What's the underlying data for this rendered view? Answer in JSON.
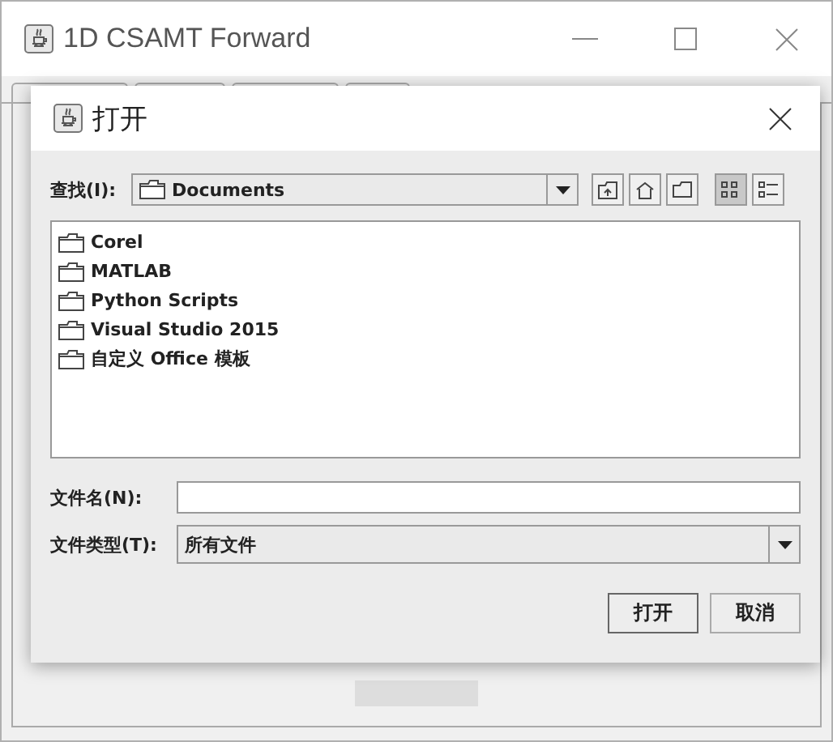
{
  "window": {
    "title": "1D CSAMT Forward"
  },
  "dialog": {
    "title": "打开",
    "look_in": {
      "label": "查找(I):",
      "value": "Documents"
    },
    "toolbar": [
      {
        "kind": "up",
        "selected": false
      },
      {
        "kind": "home",
        "selected": false
      },
      {
        "kind": "new-folder",
        "selected": false
      },
      {
        "kind": "list",
        "selected": true
      },
      {
        "kind": "details",
        "selected": false
      }
    ],
    "files": [
      {
        "name": "Corel",
        "selected": false
      },
      {
        "name": "MATLAB",
        "selected": false
      },
      {
        "name": "Python Scripts",
        "selected": false
      },
      {
        "name": "Visual Studio 2015",
        "selected": false
      },
      {
        "name": "自定义 Office 模板",
        "selected": false
      }
    ],
    "file_name": {
      "label": "文件名(N):"
    },
    "file_type": {
      "label": "文件类型(T):",
      "value": "所有文件"
    },
    "buttons": [
      "打开",
      "取消"
    ]
  }
}
